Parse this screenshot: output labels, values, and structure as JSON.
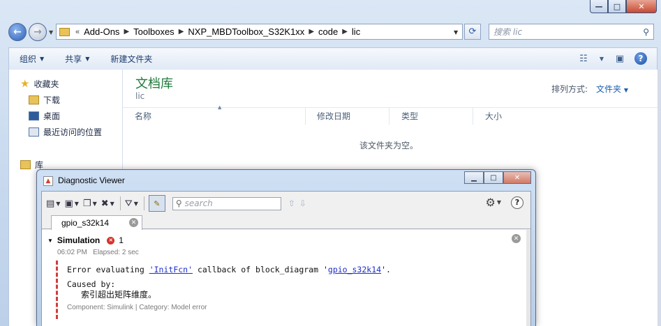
{
  "explorer": {
    "breadcrumb_prefix": "«",
    "breadcrumb": [
      "Add-Ons",
      "Toolboxes",
      "NXP_MBDToolbox_S32K1xx",
      "code",
      "lic"
    ],
    "search_placeholder": "搜索 lic",
    "toolbar": {
      "organize": "组织",
      "share": "共享",
      "new_folder": "新建文件夹"
    },
    "nav": {
      "favorites": "收藏夹",
      "downloads": "下载",
      "desktop": "桌面",
      "recent": "最近访问的位置",
      "libraries": "库"
    },
    "library_title": "文档库",
    "library_sub": "lic",
    "arrange_label": "排列方式:",
    "arrange_value": "文件夹",
    "columns": [
      "名称",
      "修改日期",
      "类型",
      "大小"
    ],
    "empty_message": "该文件夹为空。"
  },
  "diag": {
    "title": "Diagnostic Viewer",
    "search_placeholder": "search",
    "tab_label": "gpio_s32k14",
    "section_title": "Simulation",
    "error_count": "1",
    "time": "06:02 PM",
    "elapsed": "Elapsed: 2 sec",
    "error_prefix": "Error evaluating ",
    "error_link_1": "'InitFcn'",
    "error_mid": " callback of block_diagram '",
    "error_link_2": "gpio_s32k14",
    "error_suffix": "'.",
    "caused_by": "Caused by:",
    "caused_msg": "索引超出矩阵维度。",
    "component_line": "Component: Simulink | Category: Model error"
  }
}
